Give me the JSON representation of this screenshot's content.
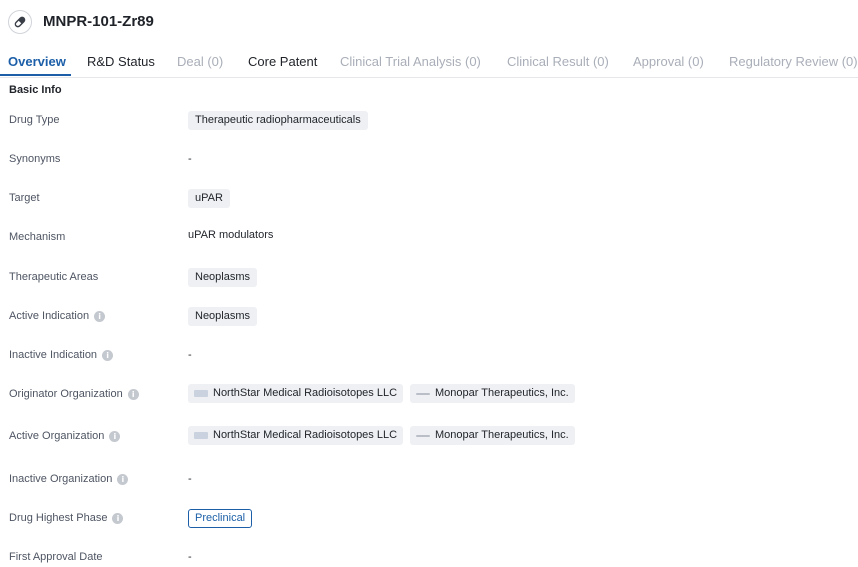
{
  "header": {
    "title": "MNPR-101-Zr89",
    "icon": "pill-icon"
  },
  "tabs": [
    {
      "label": "Overview",
      "state": "active"
    },
    {
      "label": "R&D Status",
      "state": "enabled"
    },
    {
      "label": "Deal (0)",
      "state": "disabled"
    },
    {
      "label": "Core Patent",
      "state": "enabled"
    },
    {
      "label": "Clinical Trial Analysis (0)",
      "state": "disabled"
    },
    {
      "label": "Clinical Result (0)",
      "state": "disabled"
    },
    {
      "label": "Approval (0)",
      "state": "disabled"
    },
    {
      "label": "Regulatory Review (0)",
      "state": "disabled"
    }
  ],
  "basic_info": {
    "section_title": "Basic Info",
    "drug_type": {
      "label": "Drug Type",
      "value": "Therapeutic radiopharmaceuticals"
    },
    "synonyms": {
      "label": "Synonyms",
      "value": "-"
    },
    "target": {
      "label": "Target",
      "value": "uPAR"
    },
    "mechanism": {
      "label": "Mechanism",
      "value": "uPAR modulators"
    },
    "therapeutic_areas": {
      "label": "Therapeutic Areas",
      "value": "Neoplasms"
    },
    "active_indication": {
      "label": "Active Indication",
      "value": "Neoplasms"
    },
    "inactive_indication": {
      "label": "Inactive Indication",
      "value": "-"
    },
    "originator_organization": {
      "label": "Originator Organization",
      "orgs": [
        "NorthStar Medical Radioisotopes LLC",
        "Monopar Therapeutics, Inc."
      ]
    },
    "active_organization": {
      "label": "Active Organization",
      "orgs": [
        "NorthStar Medical Radioisotopes LLC",
        "Monopar Therapeutics, Inc."
      ]
    },
    "inactive_organization": {
      "label": "Inactive Organization",
      "value": "-"
    },
    "drug_highest_phase": {
      "label": "Drug Highest Phase",
      "value": "Preclinical"
    },
    "first_approval_date": {
      "label": "First Approval Date",
      "value": "-"
    }
  },
  "colors": {
    "accent": "#1c5fa8",
    "tag_bg": "#eef0f3",
    "muted_tab": "#a9aeb8"
  },
  "info_icon": "info-icon"
}
